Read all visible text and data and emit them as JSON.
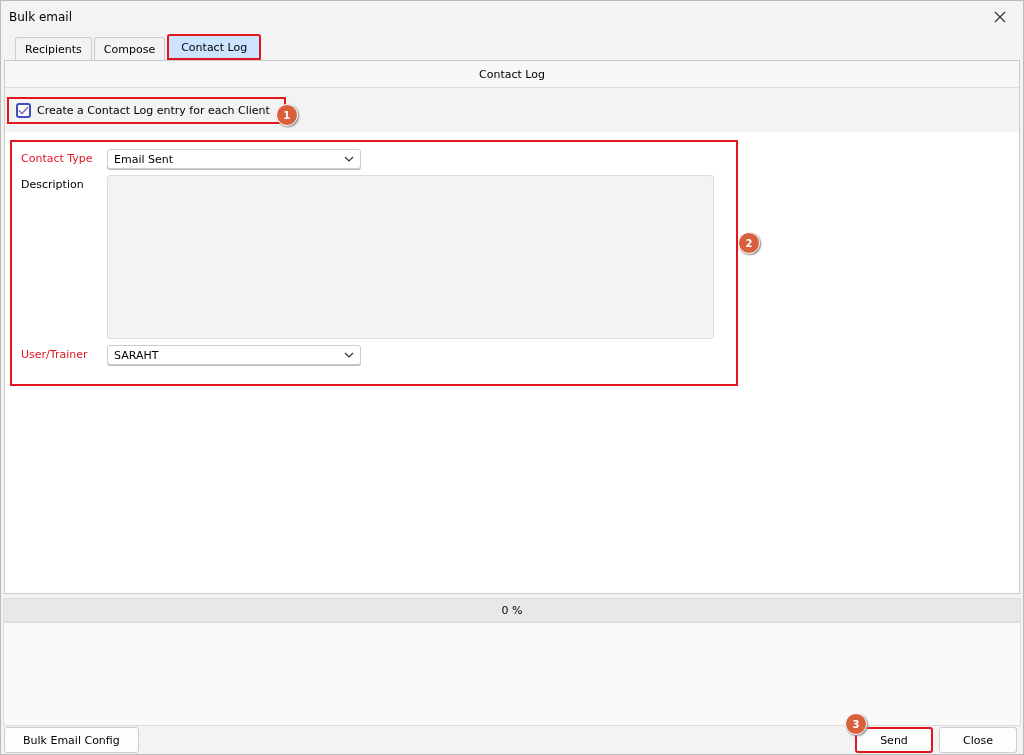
{
  "window": {
    "title": "Bulk email"
  },
  "tabs": [
    {
      "label": "Recipients",
      "selected": false,
      "highlighted": false
    },
    {
      "label": "Compose",
      "selected": false,
      "highlighted": false
    },
    {
      "label": "Contact Log",
      "selected": true,
      "highlighted": true
    }
  ],
  "panel_title": "Contact Log",
  "log_checkbox": {
    "label": "Create a Contact Log entry for each Client",
    "checked": true,
    "highlighted": true,
    "callout": "1"
  },
  "form": {
    "highlighted": true,
    "callout": "2",
    "fields": [
      {
        "kind": "dropdown",
        "label": "Contact Type",
        "required": true,
        "value": "Email Sent"
      },
      {
        "kind": "textarea",
        "label": "Description",
        "required": false
      },
      {
        "kind": "dropdown",
        "label": "User/Trainer",
        "required": true,
        "value": "SARAHT"
      }
    ]
  },
  "progress": {
    "level": 0,
    "reading": "0 %"
  },
  "buttons_left": [
    {
      "label": "Bulk Email Config",
      "highlighted": false
    }
  ],
  "buttons_right": [
    {
      "label": "Send",
      "highlighted": true,
      "callout": "3"
    },
    {
      "label": "Close",
      "highlighted": false
    }
  ]
}
